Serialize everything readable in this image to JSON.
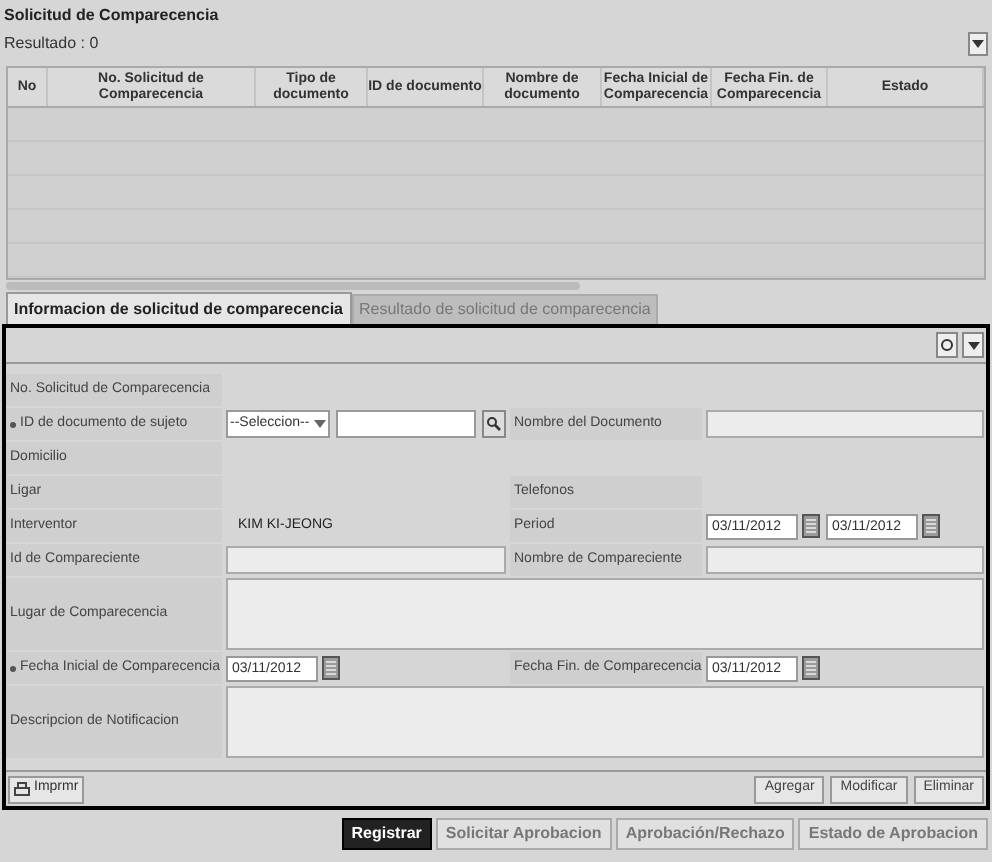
{
  "panel": {
    "title": "Solicitud de Comparecencia",
    "result_count": "Resultado : 0"
  },
  "table": {
    "columns": [
      "No",
      "No. Solicitud de Comparecencia",
      "Tipo de documento",
      "ID de documento",
      "Nombre de documento",
      "Fecha Inicial de Comparecencia",
      "Fecha Fin. de Comparecencia",
      "Estado"
    ]
  },
  "tabs": [
    {
      "label": "Informacion de solicitud de comparecencia",
      "selected": true
    },
    {
      "label": "Resultado de solicitud de comparecencia",
      "selected": false
    }
  ],
  "form": {
    "rows": [
      {
        "cells": [
          {
            "label": "No. Solicitud de Comparecencia",
            "required": false,
            "kind": "none"
          }
        ]
      },
      {
        "cells": [
          {
            "label": "ID de documento de sujeto",
            "required": true,
            "kind": "select_search",
            "value": "--Seleccion--"
          },
          {
            "label": "Nombre del Documento",
            "required": false,
            "kind": "text"
          }
        ]
      },
      {
        "cells": [
          {
            "label": "Domicilio",
            "required": false,
            "kind": "none"
          }
        ]
      },
      {
        "cells": [
          {
            "label": "Ligar",
            "required": false,
            "kind": "none"
          },
          {
            "label": "Telefonos",
            "required": false,
            "kind": "none"
          }
        ]
      },
      {
        "cells": [
          {
            "label": "Interventor",
            "required": false,
            "kind": "static",
            "value": "KIM KI-JEONG"
          },
          {
            "label": "Period",
            "required": false,
            "kind": "dates",
            "values": [
              "03/11/2012",
              "03/11/2012"
            ]
          }
        ]
      },
      {
        "cells": [
          {
            "label": "Id de Compareciente",
            "required": false,
            "kind": "text"
          },
          {
            "label": "Nombre de Compareciente",
            "required": false,
            "kind": "text"
          }
        ]
      },
      {
        "cells": [
          {
            "label": "Lugar de Comparecencia",
            "required": false,
            "kind": "textarea"
          }
        ]
      },
      {
        "cells": [
          {
            "label": "Fecha Inicial de Comparecencia",
            "required": true,
            "kind": "dates",
            "values": [
              "03/11/2012"
            ]
          },
          {
            "label": "Fecha Fin. de Comparecencia",
            "required": false,
            "kind": "dates",
            "values": [
              "03/11/2012"
            ]
          }
        ]
      },
      {
        "cells": [
          {
            "label": "Descripcion de Notificacion",
            "required": false,
            "kind": "textarea"
          }
        ]
      }
    ]
  },
  "form_footer": {
    "print": "Imprmr",
    "actions": [
      "Agregar",
      "Modificar",
      "Eliminar"
    ]
  },
  "buttons": [
    {
      "label": "Registrar",
      "kind": "primary"
    },
    {
      "label": "Solicitar Aprobacion",
      "kind": "normal"
    },
    {
      "label": "Aprobación/Rechazo",
      "kind": "normal"
    },
    {
      "label": "Estado de Aprobacion",
      "kind": "normal"
    }
  ]
}
